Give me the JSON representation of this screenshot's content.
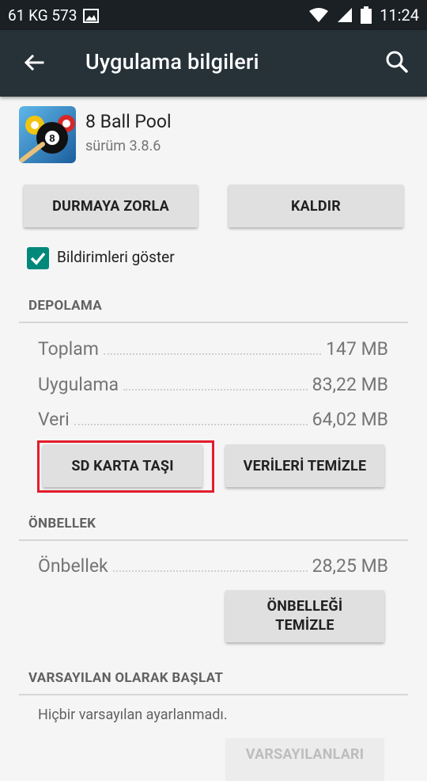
{
  "status_bar": {
    "carrier_text": "61 KG 573",
    "time": "11:24",
    "icons": [
      "image-icon",
      "wifi-icon",
      "signal-icon",
      "battery-icon"
    ]
  },
  "toolbar": {
    "title": "Uygulama bilgileri",
    "back_icon": "arrow-back-icon",
    "search_icon": "search-icon"
  },
  "app": {
    "name": "8 Ball Pool",
    "version": "sürüm 3.8.6"
  },
  "actions": {
    "force_stop": "DURMAYA ZORLA",
    "uninstall": "KALDIR"
  },
  "notifications": {
    "label": "Bildirimleri göster",
    "checked": true
  },
  "storage": {
    "header": "DEPOLAMA",
    "rows": [
      {
        "label": "Toplam",
        "value": "147 MB"
      },
      {
        "label": "Uygulama",
        "value": "83,22 MB"
      },
      {
        "label": "Veri",
        "value": "64,02 MB"
      }
    ],
    "move_button": "SD KARTA TAŞI",
    "clear_data_button": "VERİLERİ TEMİZLE"
  },
  "cache": {
    "header": "ÖNBELLEK",
    "row": {
      "label": "Önbellek",
      "value": "28,25 MB"
    },
    "clear_cache_line1": "ÖNBELLEĞİ",
    "clear_cache_line2": "TEMİZLE"
  },
  "launch_default": {
    "header": "VARSAYILAN OLARAK BAŞLAT",
    "note": "Hiçbir varsayılan ayarlanmadı.",
    "clear_defaults_button": "VARSAYILANLARI"
  },
  "colors": {
    "toolbar": "#263238",
    "status_bar": "#1b2024",
    "accent": "#00897b",
    "highlight": "#e21d2b"
  }
}
